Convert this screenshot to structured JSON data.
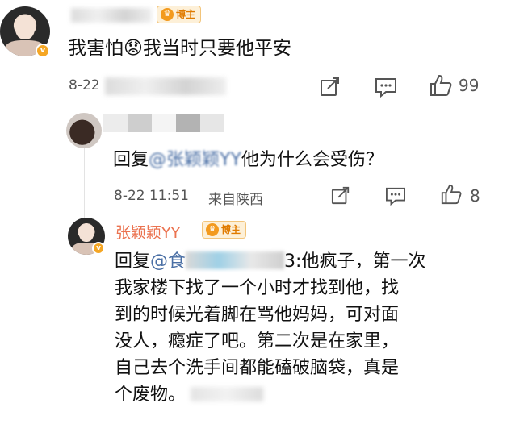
{
  "comment": {
    "username_badge": "博主",
    "text": "我害怕😟我当时只要他平安",
    "time": "8-22",
    "like_count": "99"
  },
  "reply1": {
    "prefix": "回复",
    "mention_visible": "@张颖颖YY",
    "text": "他为什么会受伤？",
    "time": "8-22 11:51",
    "location": "来自陕西",
    "like_count": "8"
  },
  "reply2": {
    "username": "张颖颖YY",
    "badge": "博主",
    "prefix": "回复",
    "mention_visible": "@食",
    "mention_tail": "3:",
    "lines": [
      "他疯子，第一次",
      "我家楼下找了一个小时才找到他，找",
      "到的时候光着脚在骂他妈妈，可对面",
      "没人，瘾症了吧。第二次是在家里，",
      "自己去个洗手间都能磕破脑袋，真是",
      "个废物。"
    ]
  },
  "icons": {
    "share": "share-icon",
    "comment": "comment-icon",
    "like": "thumbs-up-icon",
    "verified": "verified-badge-icon"
  },
  "colors": {
    "username": "#eb7350",
    "badge": "#f39a1e",
    "text": "#111111",
    "meta": "#555555"
  }
}
